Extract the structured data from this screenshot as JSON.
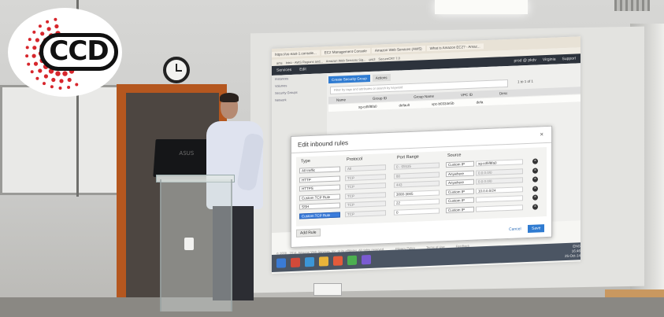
{
  "logo": {
    "text": "CCD",
    "dot_color": "#d7262c"
  },
  "laptop": {
    "brand": "ASUS"
  },
  "browser": {
    "tabs": [
      "https://us-east-1.console...",
      "EC2 Management Console",
      "Amazon Web Services (AWS)",
      "What is Amazon EC2? - Amaz..."
    ],
    "bookmarks": [
      "ams",
      "Intro - AWS Regions and...",
      "Amazon Web Services Sig...",
      "gro3",
      "SecureCRT 7.0"
    ],
    "aws_bar": {
      "services": "Services",
      "edit": "Edit",
      "user": "prod @ pkdv",
      "region": "Virginia",
      "support": "Support"
    },
    "sidebar": [
      "Instances",
      "Volumes",
      "Security Groups",
      "Network"
    ],
    "toolbar": {
      "create_label": "Create Security Group",
      "actions_label": "Actions"
    },
    "search_placeholder": "Filter by tags and attributes or search by keyword",
    "pager": "1 to 1 of 1",
    "table_header": [
      "Name",
      "Group ID",
      "Group Name",
      "VPC ID",
      "Desc"
    ],
    "table_row": [
      "",
      "sg-cd5f8fa0",
      "default",
      "vpc-b0334e5b",
      "defa"
    ],
    "footer_links": [
      "© 2008 - 2014, Amazon Web Services, Inc. or its affiliates. All rights reserved.",
      "Privacy Policy",
      "Terms of Use",
      "Feedback"
    ],
    "clock": {
      "time": "16:46",
      "date": "25-Oct-14",
      "lang": "ENG"
    }
  },
  "modal": {
    "title": "Edit inbound rules",
    "close": "×",
    "col_type": "Type",
    "col_protocol": "Protocol",
    "col_port": "Port Range",
    "col_source": "Source",
    "rows": [
      {
        "type": "All traffic",
        "protocol": "All",
        "port": "0 - 65535",
        "source_mode": "Custom IP",
        "source": "sg-cd5f8fa0",
        "editable": false
      },
      {
        "type": "HTTP",
        "protocol": "TCP",
        "port": "80",
        "source_mode": "Anywhere",
        "source": "0.0.0.0/0",
        "editable": false
      },
      {
        "type": "HTTPS",
        "protocol": "TCP",
        "port": "443",
        "source_mode": "Anywhere",
        "source": "0.0.0.0/0",
        "editable": false
      },
      {
        "type": "Custom TCP Rule",
        "protocol": "TCP",
        "port": "3000-3005",
        "source_mode": "Custom IP",
        "source": "10.0.0.0/24",
        "editable": true
      },
      {
        "type": "SSH",
        "protocol": "TCP",
        "port": "22",
        "source_mode": "Custom IP",
        "source": "",
        "editable": true
      },
      {
        "type": "Custom TCP Rule",
        "protocol": "TCP",
        "port": "0",
        "source_mode": "Custom IP",
        "source": "",
        "editable": true
      }
    ],
    "add_rule": "Add Rule",
    "cancel": "Cancel",
    "save": "Save"
  }
}
